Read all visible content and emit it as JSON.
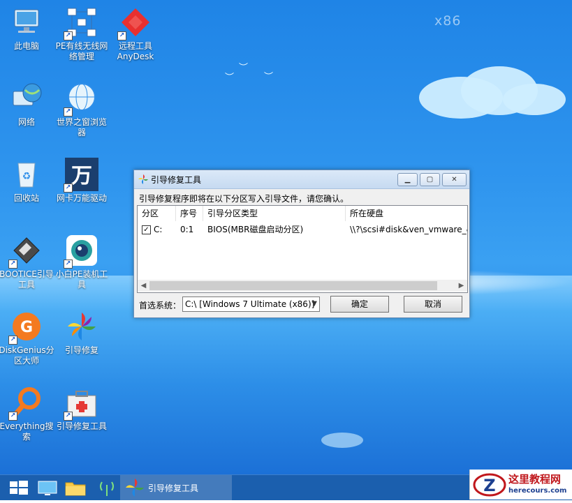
{
  "desktop": {
    "watermark_text": "x86",
    "icons": [
      {
        "label": "此电脑"
      },
      {
        "label": "PE有线无线网络管理"
      },
      {
        "label": "远程工具AnyDesk"
      },
      {
        "label": "网络"
      },
      {
        "label": "世界之窗浏览器"
      },
      {
        "label": "回收站"
      },
      {
        "label": "网卡万能驱动"
      },
      {
        "label": "BOOTICE引导工具"
      },
      {
        "label": "小白PE装机工具"
      },
      {
        "label": "DiskGenius分区大师"
      },
      {
        "label": "引导修复"
      },
      {
        "label": "Everything搜索"
      },
      {
        "label": "引导修复工具"
      }
    ],
    "driver_glyph": "万"
  },
  "dialog": {
    "title": "引导修复工具",
    "message": "引导修复程序即将在以下分区写入引导文件，请您确认。",
    "columns": [
      "分区",
      "序号",
      "引导分区类型",
      "所在硬盘"
    ],
    "rows": [
      {
        "checked": true,
        "partition": "C:",
        "index": "0:1",
        "type": "BIOS(MBR磁盘启动分区)",
        "disk": "\\\\?\\scsi#disk&ven_vmware_&"
      }
    ],
    "preferred_label": "首选系统：",
    "preferred_value": "C:\\ [Windows 7 Ultimate (x86)]",
    "ok_label": "确定",
    "cancel_label": "取消"
  },
  "taskbar": {
    "active_window_label": "引导修复工具"
  },
  "site_watermark": {
    "title": "这里教程网",
    "url": "herecours.com",
    "logo_letter": "Z"
  },
  "colors": {
    "accent": "#1b5fae",
    "desktop_blue": "#2f95ee"
  }
}
